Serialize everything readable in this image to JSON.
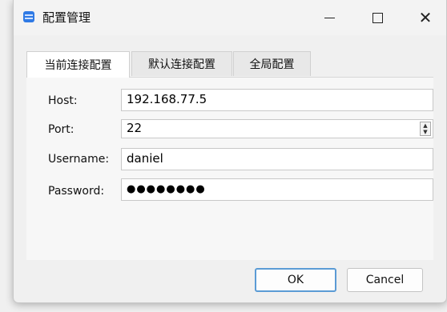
{
  "window": {
    "title": "配置管理",
    "minimize_glyph": "",
    "close_glyph": "✕"
  },
  "tabs": [
    {
      "label": "当前连接配置",
      "active": true
    },
    {
      "label": "默认连接配置",
      "active": false
    },
    {
      "label": "全局配置",
      "active": false
    }
  ],
  "form": {
    "host": {
      "label": "Host:",
      "value": "192.168.77.5"
    },
    "port": {
      "label": "Port:",
      "value": "22",
      "spinner_up": "▲",
      "spinner_down": "▼"
    },
    "username": {
      "label": "Username:",
      "value": "daniel"
    },
    "password": {
      "label": "Password:",
      "value": "●●●●●●●●"
    }
  },
  "buttons": {
    "ok_label": "OK",
    "cancel_label": "Cancel"
  },
  "colors": {
    "accent": "#5b9bd5",
    "app_icon": "#2f7ae5"
  }
}
